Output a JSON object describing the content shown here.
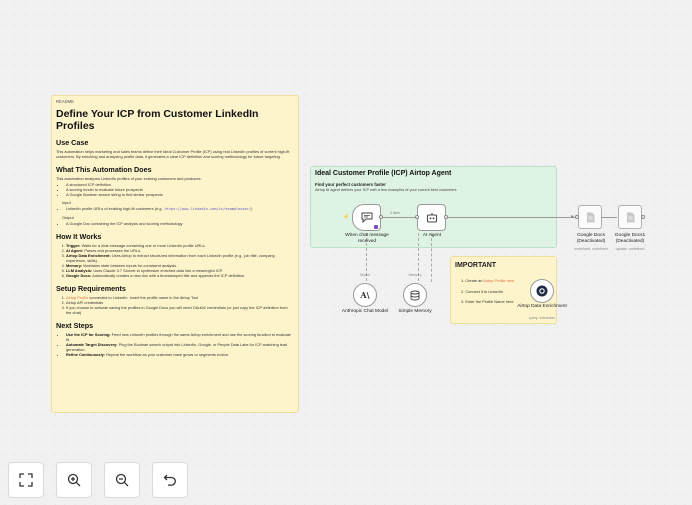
{
  "readme": {
    "tag": "README",
    "title": "Define Your ICP from Customer LinkedIn Profiles",
    "use_case_heading": "Use Case",
    "use_case_text": "This automation helps marketing and sales teams define their Ideal Customer Profile (ICP) using real LinkedIn profiles of current high-fit customers. By enriching and analyzing profile data, it generates a clear ICP definition and scoring methodology for future targeting.",
    "what_heading": "What This Automation Does",
    "what_intro": "This automation analyzes LinkedIn profiles of your existing customers and produces:",
    "what_items": [
      "A structured ICP definition",
      "A scoring model to evaluate future prospects",
      "A Google Boolean search string to find similar prospects"
    ],
    "input_label": "Input",
    "input_text": "LinkedIn profile URLs of existing high-fit customers (e.g.,",
    "input_code": "https://www.linkedin.com/in/exampleuser/",
    "input_end": ")",
    "output_label": "Output",
    "output_text": "A Google Doc containing the ICP analysis and scoring methodology",
    "how_heading": "How It Works",
    "how_items": [
      {
        "b": "Trigger:",
        "t": " Waits for a chat message containing one or more LinkedIn profile URLs."
      },
      {
        "b": "AI Agent:",
        "t": " Parses and processes the URLs."
      },
      {
        "b": "Airtop Data Enrichment:",
        "t": " Uses Airtop to extract structured information from each LinkedIn profile (e.g., job title, company, experience, skills)."
      },
      {
        "b": "Memory:",
        "t": " Maintains state between inputs for consistent analysis."
      },
      {
        "b": "LLM Analysis:",
        "t": " Uses Claude 3.7 Sonnet to synthesize enriched data into a meaningful ICP."
      },
      {
        "b": "Google Docs:",
        "t": " Automatically creates a new doc with a timestamped title and appends the ICP definition."
      }
    ],
    "setup_heading": "Setup Requirements",
    "setup_items": [
      {
        "link": "Airtop Profile",
        "t": " connected to LinkedIn. Insert the profile name in the Airtop Tool"
      },
      {
        "link": "",
        "t": "Airtop API credentials"
      },
      {
        "link": "",
        "t": "If you choose to activate saving the profiles in Google Docs you will need OAuth2 credentials (or just copy the ICP definition from the chat)"
      }
    ],
    "next_heading": "Next Steps",
    "next_items": [
      {
        "b": "Use the ICP for Scoring:",
        "t": " Feed new LinkedIn profiles through the same Airtop enrichment and use the scoring function to evaluate fit."
      },
      {
        "b": "Automate Target Discovery:",
        "t": " Plug the Boolean search output into LinkedIn, Google, or People Data Labs for ICP-matching lead generation."
      },
      {
        "b": "Refine Continuously:",
        "t": " Repeat the workflow as your customer base grows or segments evolve."
      }
    ]
  },
  "agent_note": {
    "title": "Ideal Customer Profile (ICP) Airtop Agent",
    "subtitle": "Find your perfect customers faster",
    "desc": "Airtop AI agent defines your ICP with a few examples of your current best customers"
  },
  "important": {
    "title": "IMPORTANT",
    "step1_pre": "1. Create an ",
    "step1_link": "Airtop Profile here",
    "step2": "2. Connect it to LinkedIn",
    "step3": "3. Enter the Profile Name here"
  },
  "nodes": {
    "trigger": "When chat message received",
    "agent": "AI Agent",
    "edge_label": "1 item",
    "docs1": "Google Docs (Deactivated)",
    "docs1_sub": "undefined: undefined",
    "docs2": "Google Docs1 (Deactivated)",
    "docs2_sub": "update: undefined",
    "model_tag": "Model",
    "memory_tag": "Memory",
    "model": "Anthropic Chat Model",
    "memory": "Simple Memory",
    "airtop": "Airtop Data Enrichment",
    "airtop_sub": "query: extraction"
  },
  "icons": [
    "chat-icon",
    "robot-icon",
    "doc-icon",
    "anthropic-icon",
    "database-icon",
    "airtop-icon",
    "fit-view-icon",
    "zoom-in-icon",
    "zoom-out-icon",
    "undo-icon"
  ],
  "colors": {
    "readme": "#fdf4cc",
    "agent_note": "#dff3e4",
    "link": "#e0713c",
    "canvas": "#f1f1f1"
  }
}
